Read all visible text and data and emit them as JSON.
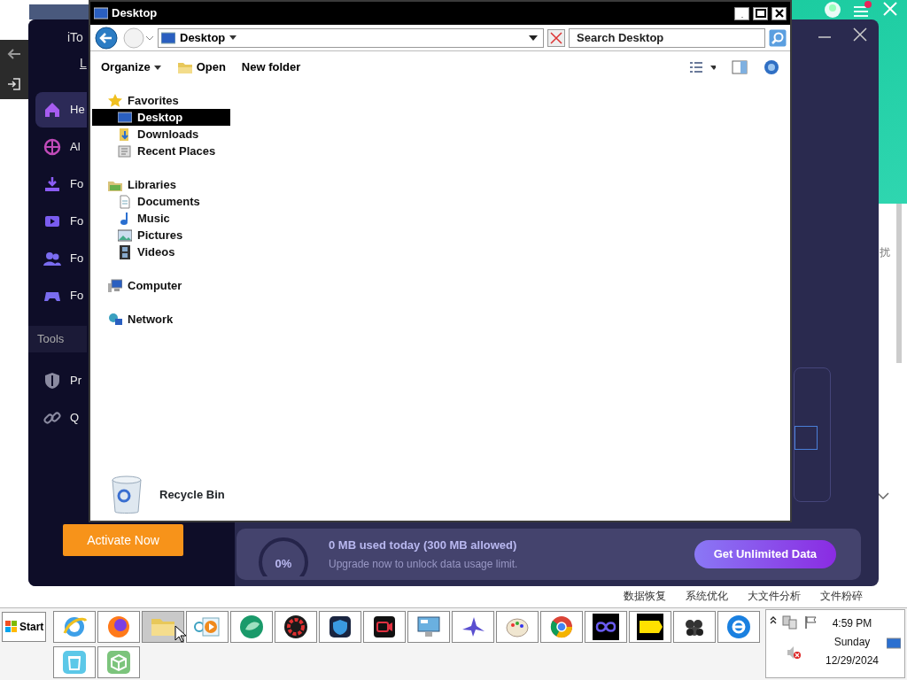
{
  "green_app": {
    "fragment": "扰",
    "tabs": [
      "数据恢复",
      "系统优化",
      "大文件分析",
      "文件粉碎"
    ]
  },
  "itop": {
    "brand": "iTo",
    "login_link": "L",
    "nav": [
      {
        "label": "He",
        "selected": true
      },
      {
        "label": "Al",
        "selected": false
      },
      {
        "label": "Fo",
        "selected": false
      },
      {
        "label": "Fo",
        "selected": false
      },
      {
        "label": "Fo",
        "selected": false
      },
      {
        "label": "Fo",
        "selected": false
      }
    ],
    "tools_heading": "Tools",
    "tools": [
      "Pr",
      "Q"
    ],
    "activate_button": "Activate Now",
    "usage": {
      "level": 0,
      "reading": "0%",
      "title": "0 MB used today (300 MB allowed)",
      "subtitle": "Upgrade now to unlock data usage limit.",
      "button": "Get Unlimited Data"
    }
  },
  "explorer": {
    "title": "Desktop",
    "address": "Desktop",
    "search_placeholder": "Search Desktop",
    "toolbar": [
      "Organize",
      "Open",
      "New folder"
    ],
    "nav_tree": [
      {
        "label": "Favorites",
        "children": [
          {
            "label": "Desktop",
            "selected": true
          },
          {
            "label": "Downloads",
            "selected": false
          },
          {
            "label": "Recent Places",
            "selected": false
          }
        ]
      },
      {
        "label": "Libraries",
        "children": [
          {
            "label": "Documents",
            "selected": false
          },
          {
            "label": "Music",
            "selected": false
          },
          {
            "label": "Pictures",
            "selected": false
          },
          {
            "label": "Videos",
            "selected": false
          }
        ]
      },
      {
        "label": "Computer"
      },
      {
        "label": "Network"
      }
    ],
    "files": [
      "Recycle Bin"
    ]
  },
  "taskbar": {
    "start": "Start",
    "apps": [
      {
        "selected": false
      },
      {
        "selected": false
      },
      {
        "selected": true
      },
      {
        "selected": false
      },
      {
        "selected": false
      },
      {
        "selected": false
      },
      {
        "selected": false
      },
      {
        "selected": false
      },
      {
        "selected": false
      },
      {
        "selected": false
      },
      {
        "selected": false
      },
      {
        "selected": false
      },
      {
        "selected": false
      },
      {
        "selected": false
      },
      {
        "selected": false
      },
      {
        "selected": false
      },
      {
        "selected": false
      },
      {
        "selected": false
      }
    ],
    "clock": {
      "time": "4:59 PM",
      "day": "Sunday",
      "date": "12/29/2024"
    }
  }
}
